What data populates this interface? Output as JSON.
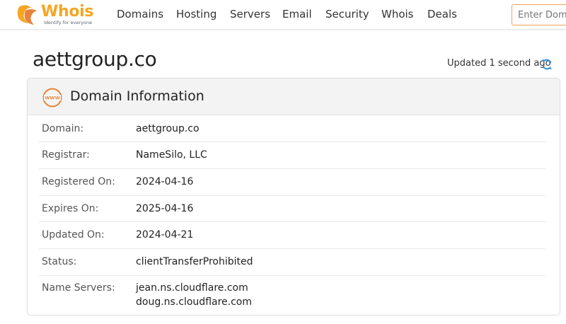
{
  "navbar": {
    "logo": {
      "text": "Whois",
      "tagline": "Identify for everyone"
    },
    "items": [
      {
        "label": "Domains"
      },
      {
        "label": "Hosting"
      },
      {
        "label": "Servers"
      },
      {
        "label": "Email"
      },
      {
        "label": "Security"
      },
      {
        "label": "Whois"
      },
      {
        "label": "Deals"
      }
    ],
    "search": {
      "placeholder": "Enter Domain",
      "value": ""
    }
  },
  "page": {
    "title": "aettgroup.co",
    "updated": "Updated 1 second ago"
  },
  "card": {
    "title": "Domain Information",
    "icon": "www-icon",
    "rows": [
      {
        "label": "Domain:",
        "values": [
          "aettgroup.co"
        ]
      },
      {
        "label": "Registrar:",
        "values": [
          "NameSilo, LLC"
        ]
      },
      {
        "label": "Registered On:",
        "values": [
          "2024-04-16"
        ]
      },
      {
        "label": "Expires On:",
        "values": [
          "2025-04-16"
        ]
      },
      {
        "label": "Updated On:",
        "values": [
          "2024-04-21"
        ]
      },
      {
        "label": "Status:",
        "values": [
          "clientTransferProhibited"
        ]
      },
      {
        "label": "Name Servers:",
        "values": [
          "jean.ns.cloudflare.com",
          "doug.ns.cloudflare.com"
        ]
      }
    ]
  },
  "colors": {
    "brand_orange": "#f5a623",
    "accent_orange": "#e8833a",
    "refresh_blue": "#2f8fd8"
  }
}
